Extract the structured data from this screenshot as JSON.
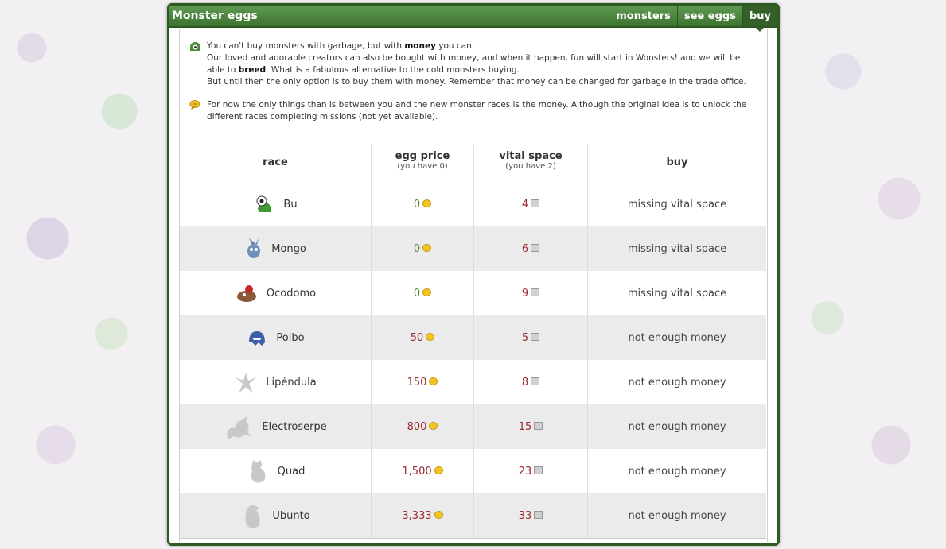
{
  "header": {
    "title": "Monster eggs",
    "tabs": [
      "monsters",
      "see eggs",
      "buy"
    ]
  },
  "info": {
    "p1_a": "You can't buy monsters with garbage, but with ",
    "p1_bold": "money",
    "p1_b": " you can.",
    "p1_line2_a": "Our loved and adorable creators can also be bought with money, and when it happen, fun will start in Wonsters! and we will be able to ",
    "p1_line2_bold": "breed",
    "p1_line2_b": ". What is a fabulous alternative to the cold monsters buying.",
    "p1_line3": "But until then the only option is to buy them with money. Remember that money can be changed for garbage in the trade office.",
    "p2": "For now the only things than is between you and the new monster races is the money. Although the original idea is to unlock the different races completing missions (not yet available)."
  },
  "table": {
    "headers": {
      "race": "race",
      "egg_price": "egg price",
      "egg_price_sub": "(you have 0)",
      "vital_space": "vital space",
      "vital_space_sub": "(you have 2)",
      "buy": "buy"
    },
    "rows": [
      {
        "race": "Bu",
        "price": "0",
        "space": "4",
        "buy": "missing vital space",
        "price_color": "green"
      },
      {
        "race": "Mongo",
        "price": "0",
        "space": "6",
        "buy": "missing vital space",
        "price_color": "green"
      },
      {
        "race": "Ocodomo",
        "price": "0",
        "space": "9",
        "buy": "missing vital space",
        "price_color": "green"
      },
      {
        "race": "Polbo",
        "price": "50",
        "space": "5",
        "buy": "not enough money",
        "price_color": "red"
      },
      {
        "race": "Lipéndula",
        "price": "150",
        "space": "8",
        "buy": "not enough money",
        "price_color": "red"
      },
      {
        "race": "Electroserpe",
        "price": "800",
        "space": "15",
        "buy": "not enough money",
        "price_color": "red"
      },
      {
        "race": "Quad",
        "price": "1,500",
        "space": "23",
        "buy": "not enough money",
        "price_color": "red"
      },
      {
        "race": "Ubunto",
        "price": "3,333",
        "space": "33",
        "buy": "not enough money",
        "price_color": "red"
      }
    ]
  },
  "colors": {
    "header_green": "#3d7331",
    "price_green": "#4a8f2a",
    "price_red": "#9b2a32"
  }
}
